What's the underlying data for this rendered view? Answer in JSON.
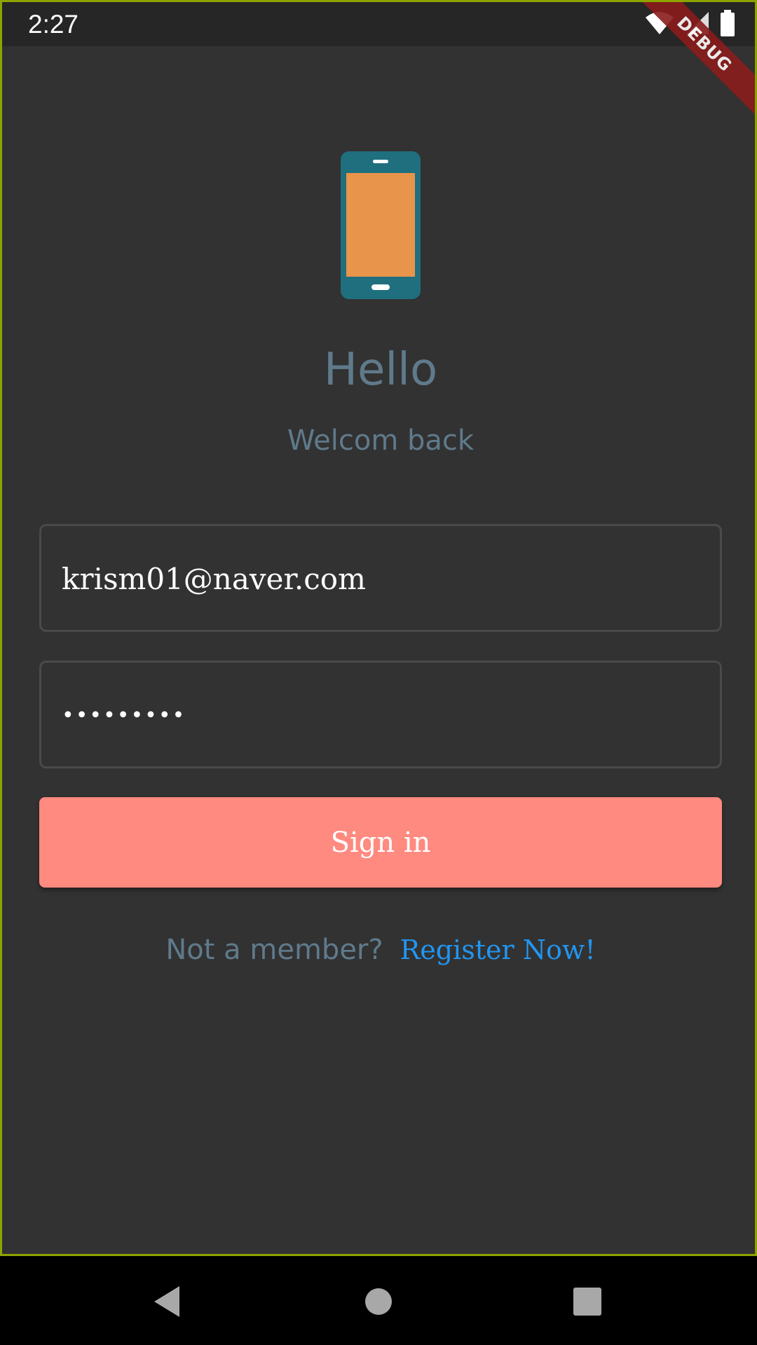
{
  "status_bar": {
    "time": "2:27",
    "icons": [
      "wifi-icon",
      "signal-icon",
      "battery-icon"
    ]
  },
  "debug_banner": {
    "label": "DEBUG"
  },
  "header": {
    "icon": "smartphone-icon",
    "title": "Hello",
    "subtitle": "Welcom back"
  },
  "form": {
    "email_value": "krism01@naver.com",
    "password_value": "•••••••••"
  },
  "signin_button": {
    "label": "Sign in"
  },
  "register": {
    "prompt": "Not a member?",
    "link_label": "Register Now!"
  },
  "nav_bar": {
    "icons": [
      "back-icon",
      "home-icon",
      "recents-icon"
    ]
  },
  "colors": {
    "background": "#323232",
    "accent_button": "#ff8a80",
    "link": "#2196f3",
    "muted_text": "#5f7a8b",
    "phone_body": "#1f6f7f",
    "phone_screen": "#e8944a"
  }
}
